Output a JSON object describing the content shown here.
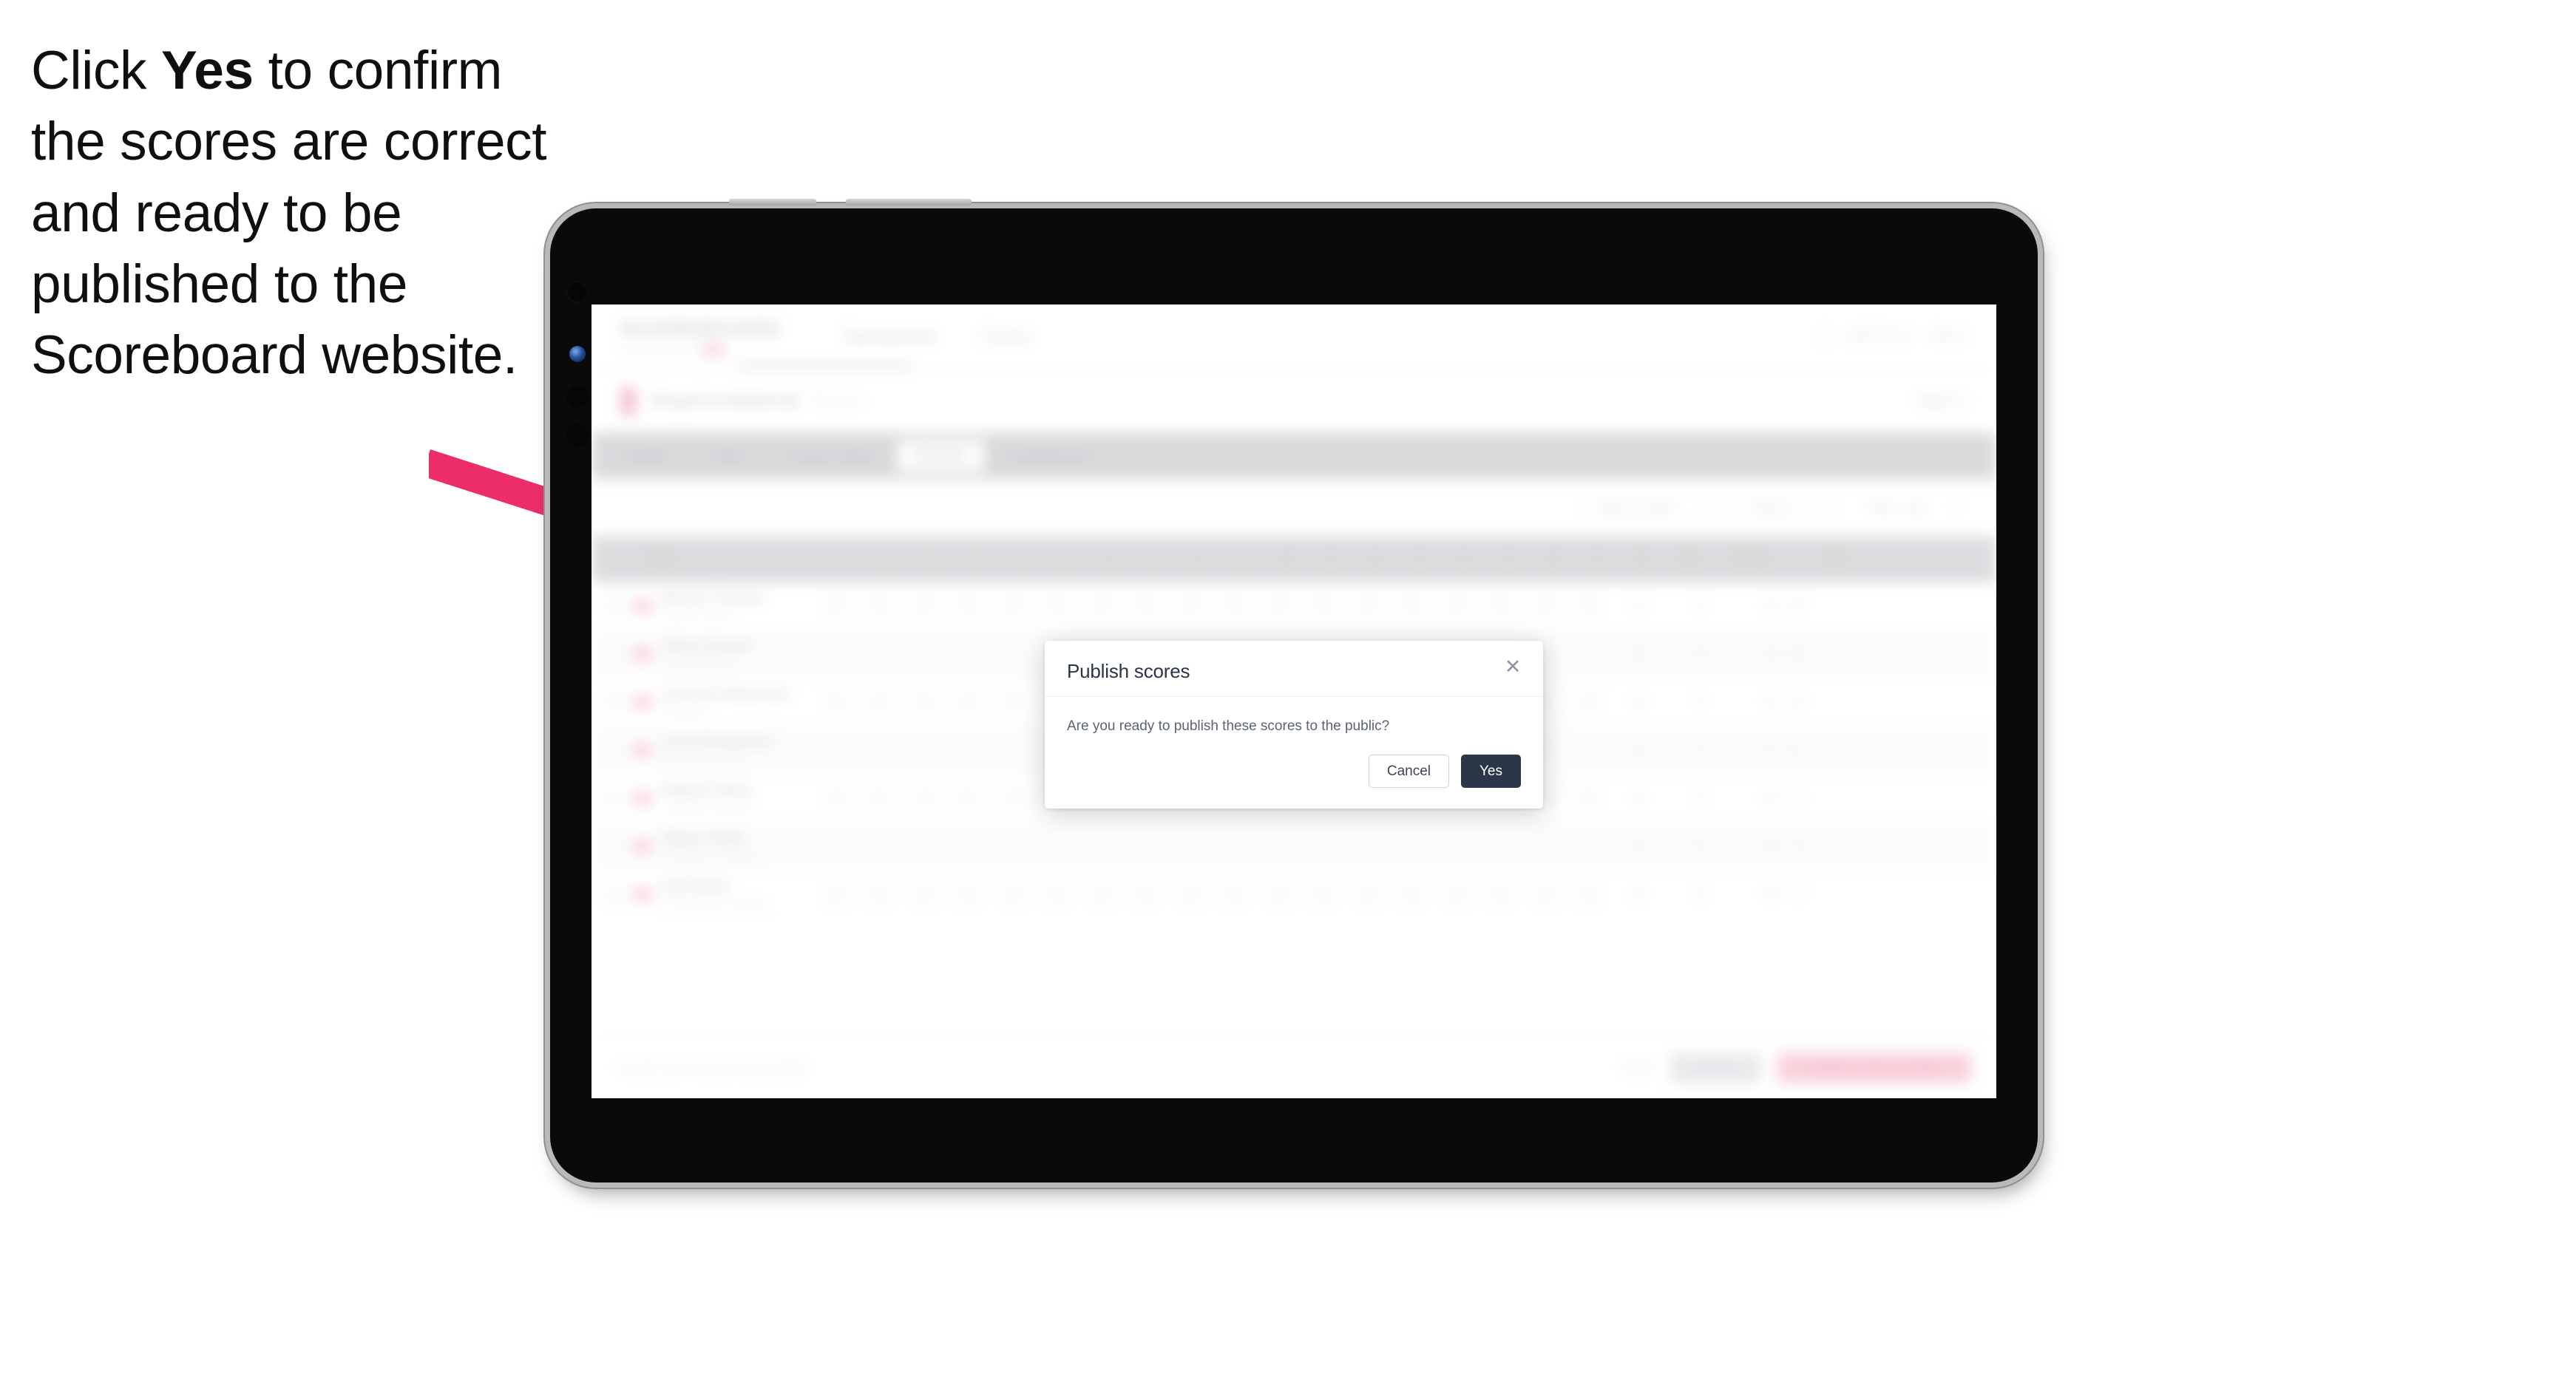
{
  "caption": {
    "pre": "Click ",
    "emphasis": "Yes",
    "post": " to confirm the scores are correct and ready to be published to the Scoreboard website."
  },
  "annotation": {
    "arrow_color": "#ED2D68",
    "arrow_label": "pointer-arrow-to-yes-button"
  },
  "device": {
    "type": "tablet",
    "frame_color": "#b9b9bc",
    "screen_color": "#0a0a0a"
  },
  "app": {
    "header": {
      "brand_word": "SCOREBOARD",
      "brand_sub": "POWERED BY",
      "nav": [
        {
          "label": "Tournaments"
        },
        {
          "label": "Events"
        }
      ],
      "right": [
        {
          "label": "Add Event"
        },
        {
          "label": "Menu"
        }
      ]
    },
    "event": {
      "name": "Royal Invitational",
      "sub": "Round 1",
      "right": "Week 3"
    },
    "tabs": [
      {
        "label": "Details",
        "selected": false
      },
      {
        "label": "Field",
        "selected": false
      },
      {
        "label": "Course Setup",
        "selected": false
      },
      {
        "label": "Results",
        "selected": true
      },
      {
        "label": "Leaderboard",
        "selected": false
      }
    ],
    "toolbar": {
      "left_label": "",
      "filters": [
        {
          "label": "Filter by team"
        },
        {
          "label": "Round"
        },
        {
          "label": "Team only"
        }
      ]
    },
    "table": {
      "columns": {
        "player": "Player",
        "holes": [
          "1",
          "2",
          "3",
          "4",
          "5",
          "6",
          "7",
          "8",
          "9",
          "10",
          "11",
          "12",
          "13",
          "14",
          "15",
          "16",
          "17",
          "18"
        ],
        "thru": "Thru",
        "penalty": "Penalty",
        "total": "Total"
      },
      "rows": [
        {
          "badge": "T1",
          "name": "Marcus Thomas",
          "sub": "Eastern School",
          "scores": [
            "4",
            "3",
            "5",
            "4",
            "4",
            "3",
            "4",
            "5",
            "4",
            "4",
            "3",
            "4",
            "4",
            "5",
            "3",
            "4",
            "4",
            "4"
          ],
          "thru": "18",
          "penalty": "70",
          "total": [
            "-02",
            "68"
          ]
        },
        {
          "badge": "T1",
          "name": "Oliver Pennell",
          "sub": "Central College",
          "scores": [
            "4",
            "4",
            "4",
            "5",
            "3",
            "4",
            "4",
            "4",
            "5",
            "3",
            "4",
            "4",
            "4",
            "4",
            "4",
            "4",
            "3",
            "5"
          ],
          "thru": "18",
          "penalty": "70",
          "total": [
            "-02",
            "68"
          ]
        },
        {
          "badge": "T3",
          "name": "Cameron Robertson",
          "sub": "Northfield",
          "scores": [
            "5",
            "4",
            "4",
            "4",
            "4",
            "4",
            "3",
            "5",
            "4",
            "4",
            "4",
            "3",
            "4",
            "5",
            "4",
            "4",
            "4",
            "4"
          ],
          "thru": "18",
          "penalty": "71",
          "total": [
            "-01",
            "69"
          ]
        },
        {
          "badge": "T4",
          "name": "Chris Richardson",
          "sub": "Hillview University",
          "scores": [
            "4",
            "5",
            "4",
            "4",
            "4",
            "3",
            "4",
            "4",
            "5",
            "4",
            "4",
            "4",
            "4",
            "4",
            "4",
            "4",
            "5",
            "3"
          ],
          "thru": "18",
          "penalty": "71",
          "total": [
            "E",
            "70"
          ]
        },
        {
          "badge": "T5",
          "name": "Ridwan Abdul",
          "sub": "Lakeside University",
          "scores": [
            "4",
            "4",
            "5",
            "4",
            "3",
            "4",
            "4",
            "4",
            "4",
            "5",
            "4",
            "4",
            "3",
            "4",
            "4",
            "5",
            "4",
            "4"
          ],
          "thru": "18",
          "penalty": "72",
          "total": [
            "+01",
            "71"
          ]
        },
        {
          "badge": "T6",
          "name": "Wayne Smith",
          "sub": "Greenway University",
          "scores": [
            "4",
            "4",
            "4",
            "4",
            "4",
            "5",
            "4",
            "4",
            "4",
            "4",
            "4",
            "4",
            "5",
            "4",
            "4",
            "4",
            "4",
            "4"
          ],
          "thru": "18",
          "penalty": "72",
          "total": [
            "+02",
            "72"
          ]
        },
        {
          "badge": "T7",
          "name": "Nick Baker",
          "sub": "Summerside University",
          "scores": [
            "5",
            "4",
            "4",
            "4",
            "5",
            "4",
            "4",
            "4",
            "4",
            "4",
            "4",
            "5",
            "4",
            "4",
            "4",
            "4",
            "4",
            "4"
          ],
          "thru": "18",
          "penalty": "73",
          "total": [
            "+03",
            "73"
          ]
        }
      ]
    },
    "footer": {
      "note": "Results synchronised successfully",
      "link": "Reset",
      "secondary_button": "Save",
      "primary_button": "Publish scores to public"
    }
  },
  "modal": {
    "title": "Publish scores",
    "close_icon": "✕",
    "message": "Are you ready to publish these scores to the public?",
    "cancel_label": "Cancel",
    "confirm_label": "Yes",
    "confirm_bg": "#2b3648"
  }
}
